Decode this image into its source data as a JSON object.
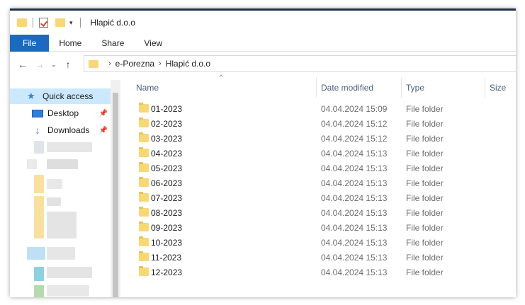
{
  "window": {
    "title": "Hlapić d.o.o"
  },
  "ribbon": {
    "tabs": [
      "File",
      "Home",
      "Share",
      "View"
    ]
  },
  "address": {
    "crumbs": [
      "e-Porezna",
      "Hlapić d.o.o"
    ]
  },
  "nav": {
    "quick_access": "Quick access",
    "desktop": "Desktop",
    "downloads": "Downloads"
  },
  "columns": {
    "name": "Name",
    "date": "Date modified",
    "type": "Type",
    "size": "Size"
  },
  "files": [
    {
      "name": "01-2023",
      "date": "04.04.2024 15:09",
      "type": "File folder"
    },
    {
      "name": "02-2023",
      "date": "04.04.2024 15:12",
      "type": "File folder"
    },
    {
      "name": "03-2023",
      "date": "04.04.2024 15:12",
      "type": "File folder"
    },
    {
      "name": "04-2023",
      "date": "04.04.2024 15:13",
      "type": "File folder"
    },
    {
      "name": "05-2023",
      "date": "04.04.2024 15:13",
      "type": "File folder"
    },
    {
      "name": "06-2023",
      "date": "04.04.2024 15:13",
      "type": "File folder"
    },
    {
      "name": "07-2023",
      "date": "04.04.2024 15:13",
      "type": "File folder"
    },
    {
      "name": "08-2023",
      "date": "04.04.2024 15:13",
      "type": "File folder"
    },
    {
      "name": "09-2023",
      "date": "04.04.2024 15:13",
      "type": "File folder"
    },
    {
      "name": "10-2023",
      "date": "04.04.2024 15:13",
      "type": "File folder"
    },
    {
      "name": "11-2023",
      "date": "04.04.2024 15:13",
      "type": "File folder"
    },
    {
      "name": "12-2023",
      "date": "04.04.2024 15:13",
      "type": "File folder"
    }
  ],
  "icons": {
    "folder": "folder-icon",
    "properties": "properties-icon",
    "quick_access": "star-icon",
    "desktop": "desktop-icon",
    "downloads": "download-icon",
    "pin": "pin-icon",
    "back": "back-arrow-icon",
    "forward": "forward-arrow-icon",
    "recent": "chevron-down-icon",
    "up": "up-arrow-icon"
  },
  "colors": {
    "file_tab": "#1a6bbf",
    "folder": "#f8d775",
    "selected": "#cce8ff",
    "header_text": "#4c607a"
  }
}
